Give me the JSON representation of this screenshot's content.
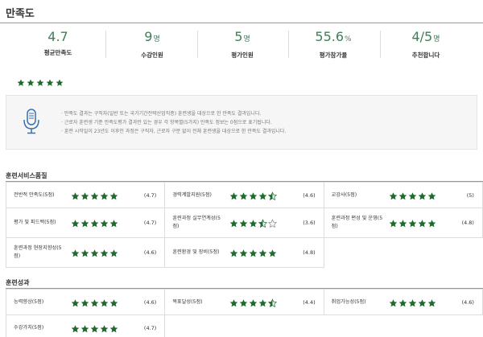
{
  "page": {
    "title": "만족도"
  },
  "stats": [
    {
      "value": "4.7",
      "unit": "",
      "label": "평균만족도"
    },
    {
      "value": "9",
      "unit": "명",
      "label": "수강인원"
    },
    {
      "value": "5",
      "unit": "명",
      "label": "평가인원"
    },
    {
      "value": "55.6",
      "unit": "%",
      "label": "평가참가율"
    },
    {
      "value": "4/5",
      "unit": "명",
      "label": "추천합니다"
    }
  ],
  "overall_rating": {
    "stars": 5,
    "max": 5
  },
  "notice": {
    "icon": "microphone-icon",
    "lines": [
      "· 만족도 결과는 구직자(일반 또는 국가기간전략산업직종) 훈련생을 대상으로 한 만족도 결과입니다.",
      "· 근로자 훈련생 기준 만족도평가 결과만 있는 경우 각 항목별(5가지) 만족도 정보는 0점으로 표기됩니다.",
      "· 훈련 시작일이 23년도 이후인 과정은 구직자, 근로자 구분 없이 전체 훈련생을 대상으로 한 만족도 결과입니다."
    ]
  },
  "sections": [
    {
      "title": "훈련서비스품질",
      "rows": [
        [
          {
            "label": "전반적 만족도(5점)",
            "rating": 5,
            "score": "(4.7)"
          },
          {
            "label": "경력계발지원(5점)",
            "rating": 4.5,
            "score": "(4.6)"
          },
          {
            "label": "교강사(5점)",
            "rating": 5,
            "score": "(5)"
          }
        ],
        [
          {
            "label": "평가 및 피드백(5점)",
            "rating": 5,
            "score": "(4.7)"
          },
          {
            "label": "훈련과정 실무연계성(5점)",
            "rating": 3.5,
            "score": "(3.6)"
          },
          {
            "label": "훈련과정 편성 및 운영(5점)",
            "rating": 5,
            "score": "(4.8)"
          }
        ],
        [
          {
            "label": "훈련과정 현장지향성(5점)",
            "rating": 5,
            "score": "(4.6)"
          },
          {
            "label": "훈련환경 및 장비(5점)",
            "rating": 5,
            "score": "(4.8)"
          },
          null
        ]
      ]
    },
    {
      "title": "훈련성과",
      "rows": [
        [
          {
            "label": "능력향상(5점)",
            "rating": 5,
            "score": "(4.6)"
          },
          {
            "label": "목표달성(5점)",
            "rating": 4.5,
            "score": "(4.4)"
          },
          {
            "label": "취업가능성(5점)",
            "rating": 5,
            "score": "(4.6)"
          }
        ],
        [
          {
            "label": "수강가치(5점)",
            "rating": 5,
            "score": "(4.7)"
          },
          null,
          null
        ]
      ]
    }
  ],
  "colors": {
    "accent": "#3f7e57",
    "star_fill": "#1f6b2e",
    "star_empty": "#888888"
  }
}
